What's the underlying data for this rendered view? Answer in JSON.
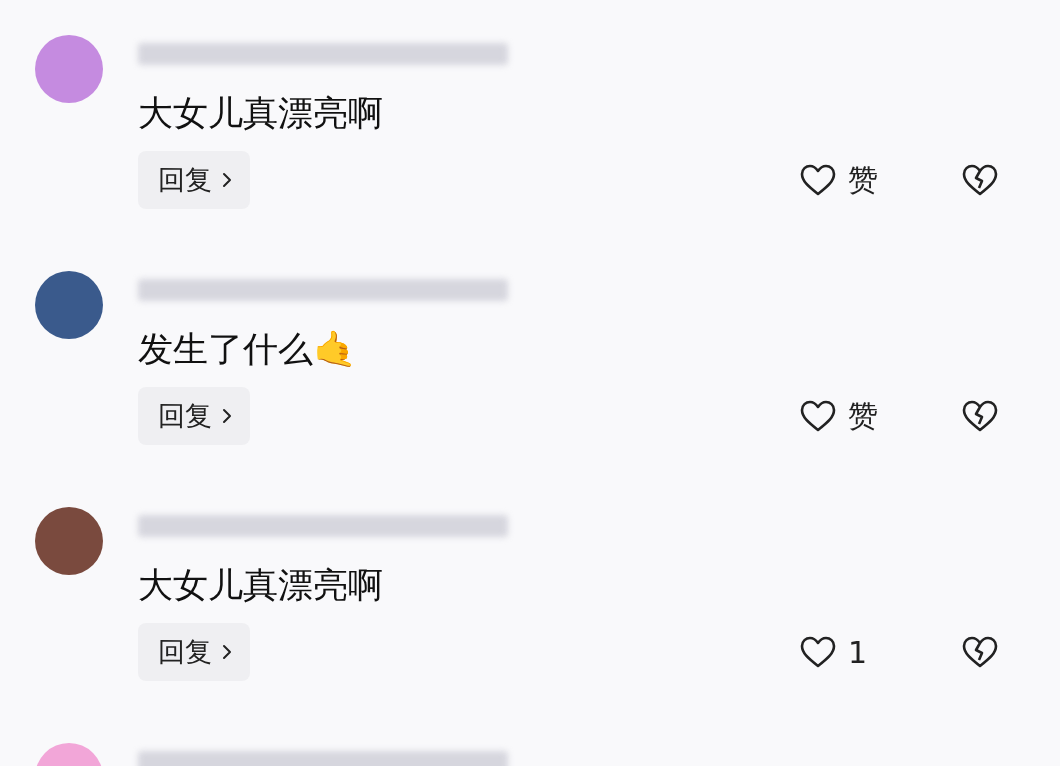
{
  "comments": [
    {
      "kind": "full",
      "color": "#c58be0",
      "text": "大女儿真漂亮啊",
      "reply": "回复",
      "like": "赞"
    },
    {
      "kind": "full",
      "color": "#3a5a8c",
      "text": "发生了什么🤙",
      "reply": "回复",
      "like": "赞"
    },
    {
      "kind": "full",
      "color": "#7a4a3e",
      "text": "大女儿真漂亮啊",
      "reply": "回复",
      "like": "1"
    },
    {
      "kind": "partial",
      "color": "#f2a6d8"
    }
  ]
}
